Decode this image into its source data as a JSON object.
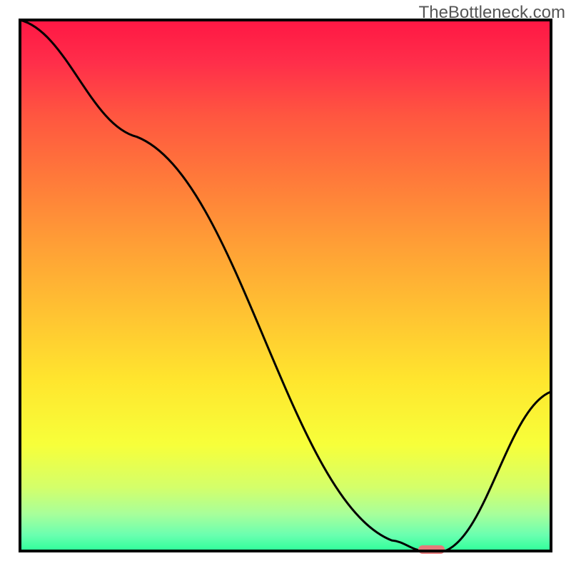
{
  "watermark": "TheBottleneck.com",
  "chart_data": {
    "type": "line",
    "title": "",
    "xlabel": "",
    "ylabel": "",
    "xlim": [
      0,
      100
    ],
    "ylim": [
      0,
      100
    ],
    "x": [
      0,
      22,
      70,
      76,
      80,
      100
    ],
    "values": [
      100,
      78,
      2,
      0,
      0,
      30
    ],
    "marker": {
      "x_start": 75,
      "x_end": 80,
      "y": 0,
      "color": "#e47a7a"
    },
    "gradient_stops": [
      {
        "offset": 0.0,
        "color": "#ff1744"
      },
      {
        "offset": 0.08,
        "color": "#ff2e4a"
      },
      {
        "offset": 0.18,
        "color": "#ff5640"
      },
      {
        "offset": 0.3,
        "color": "#ff7a3a"
      },
      {
        "offset": 0.42,
        "color": "#ff9e36"
      },
      {
        "offset": 0.55,
        "color": "#ffc232"
      },
      {
        "offset": 0.68,
        "color": "#ffe62e"
      },
      {
        "offset": 0.8,
        "color": "#f7ff3a"
      },
      {
        "offset": 0.88,
        "color": "#d4ff6a"
      },
      {
        "offset": 0.93,
        "color": "#a8ff9a"
      },
      {
        "offset": 0.97,
        "color": "#6affb0"
      },
      {
        "offset": 1.0,
        "color": "#2eff9a"
      }
    ],
    "frame_color": "#000000",
    "line_color": "#000000",
    "line_width": 3
  }
}
